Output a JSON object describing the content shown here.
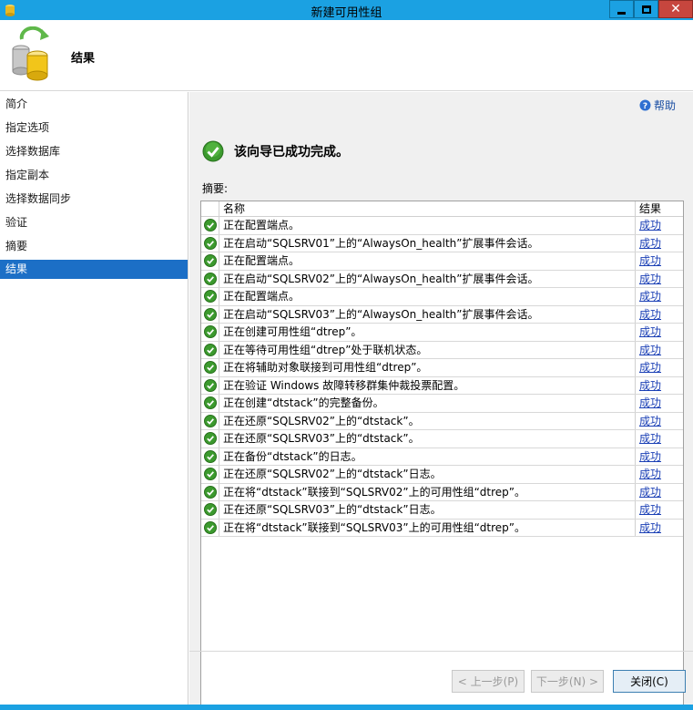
{
  "window": {
    "title": "新建可用性组"
  },
  "header": {
    "title": "结果"
  },
  "sidebar": {
    "items": [
      {
        "label": "简介"
      },
      {
        "label": "指定选项"
      },
      {
        "label": "选择数据库"
      },
      {
        "label": "指定副本"
      },
      {
        "label": "选择数据同步"
      },
      {
        "label": "验证"
      },
      {
        "label": "摘要"
      },
      {
        "label": "结果"
      }
    ],
    "active_index": 7
  },
  "main": {
    "help_label": "帮助",
    "status_message": "该向导已成功完成。",
    "summary_label": "摘要:",
    "table": {
      "headers": {
        "name": "名称",
        "result": "结果"
      },
      "rows": [
        {
          "name": "正在配置端点。",
          "result": "成功"
        },
        {
          "name": "正在启动“SQLSRV01”上的“AlwaysOn_health”扩展事件会话。",
          "result": "成功"
        },
        {
          "name": "正在配置端点。",
          "result": "成功"
        },
        {
          "name": "正在启动“SQLSRV02”上的“AlwaysOn_health”扩展事件会话。",
          "result": "成功"
        },
        {
          "name": "正在配置端点。",
          "result": "成功"
        },
        {
          "name": "正在启动“SQLSRV03”上的“AlwaysOn_health”扩展事件会话。",
          "result": "成功"
        },
        {
          "name": "正在创建可用性组“dtrep”。",
          "result": "成功"
        },
        {
          "name": "正在等待可用性组“dtrep”处于联机状态。",
          "result": "成功"
        },
        {
          "name": "正在将辅助对象联接到可用性组“dtrep”。",
          "result": "成功"
        },
        {
          "name": "正在验证 Windows 故障转移群集仲裁投票配置。",
          "result": "成功"
        },
        {
          "name": "正在创建“dtstack”的完整备份。",
          "result": "成功"
        },
        {
          "name": "正在还原“SQLSRV02”上的“dtstack”。",
          "result": "成功"
        },
        {
          "name": "正在还原“SQLSRV03”上的“dtstack”。",
          "result": "成功"
        },
        {
          "name": "正在备份“dtstack”的日志。",
          "result": "成功"
        },
        {
          "name": "正在还原“SQLSRV02”上的“dtstack”日志。",
          "result": "成功"
        },
        {
          "name": "正在将“dtstack”联接到“SQLSRV02”上的可用性组“dtrep”。",
          "result": "成功"
        },
        {
          "name": "正在还原“SQLSRV03”上的“dtstack”日志。",
          "result": "成功"
        },
        {
          "name": "正在将“dtstack”联接到“SQLSRV03”上的可用性组“dtrep”。",
          "result": "成功"
        }
      ]
    }
  },
  "footer": {
    "prev_label": "< 上一步(P)",
    "next_label": "下一步(N) >",
    "close_label": "关闭(C)"
  },
  "colors": {
    "titlebar": "#1ba1e2",
    "active_nav": "#1c6fc6",
    "success_green": "#3c9a2e",
    "link": "#1a3fb5"
  },
  "icons": {
    "app": "database-wizard-icon",
    "header": "database-sync-icon",
    "help": "help-icon",
    "status": "success-check-icon",
    "row": "success-check-icon"
  }
}
